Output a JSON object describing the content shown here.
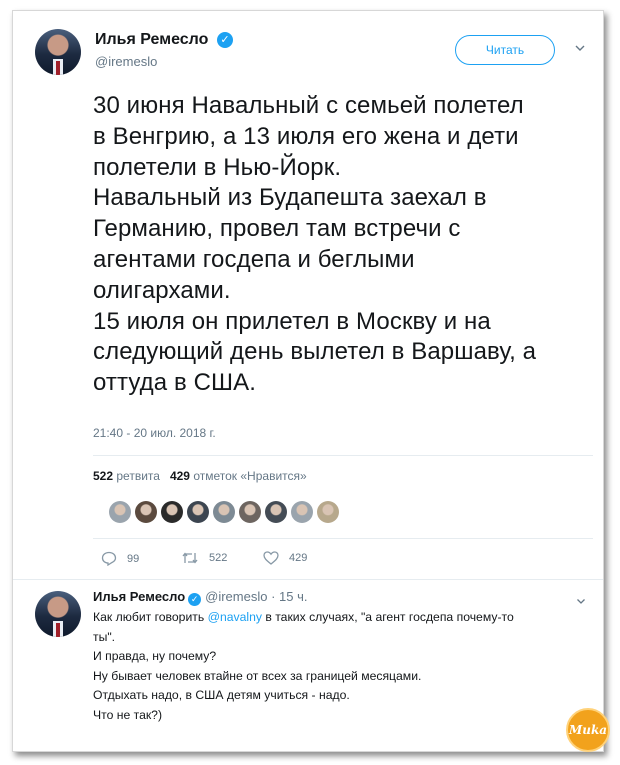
{
  "tweet": {
    "author_name": "Илья Ремесло",
    "verified_glyph": "✓",
    "author_handle": "@iremeslo",
    "follow_label": "Читать",
    "text_lines": [
      "30 июня Навальный с семьей  полетел",
      "в Венгрию, а 13 июля его жена и дети",
      "полетели в Нью-Йорк.",
      "Навальный из Будапешта заехал в",
      "Германию, провел там встречи с",
      "агентами госдепа и беглыми",
      "олигархами.",
      "15 июля он прилетел в Москву и на",
      "следующий день вылетел в Варшаву, а",
      "оттуда в США."
    ],
    "timestamp": "21:40 - 20 июл. 2018 г.",
    "retweets_count": "522",
    "retweets_label": "ретвита",
    "likes_count": "429",
    "likes_label": "отметок «Нравится»",
    "likers": [
      {
        "icon": "liker-avatar",
        "color": "#9aa4ad"
      },
      {
        "icon": "liker-avatar",
        "color": "#5b4a3e"
      },
      {
        "icon": "liker-avatar",
        "color": "#2a2a2a"
      },
      {
        "icon": "liker-avatar",
        "color": "#3c4550"
      },
      {
        "icon": "liker-avatar",
        "color": "#7d8a94"
      },
      {
        "icon": "liker-avatar",
        "color": "#6d6560"
      },
      {
        "icon": "liker-avatar",
        "color": "#444c55"
      },
      {
        "icon": "liker-avatar",
        "color": "#9aa4ad"
      },
      {
        "icon": "liker-avatar",
        "color": "#b7a88c"
      }
    ],
    "actions": {
      "replies": "99",
      "retweets": "522",
      "likes": "429"
    }
  },
  "reply": {
    "author_name": "Илья Ремесло",
    "verified_glyph": "✓",
    "author_handle": "@iremeslo",
    "time": "· 15 ч.",
    "line1_before": "Как любит говорить ",
    "mention": "@navalny",
    "line1_after": " в таких случаях, \"а агент госдепа почему-то",
    "lines": [
      "ты\".",
      "И правда, ну почему?",
      "Ну бывает человек втайне от всех за границей месяцами.",
      "Отдыхать надо, в США детям  учиться - надо.",
      "Что не так?)"
    ]
  },
  "colors": {
    "accent": "#1da1f2",
    "text": "#14171a",
    "muted": "#657786",
    "watermark": "#f2a21c"
  },
  "watermark": {
    "text": "Muka"
  }
}
